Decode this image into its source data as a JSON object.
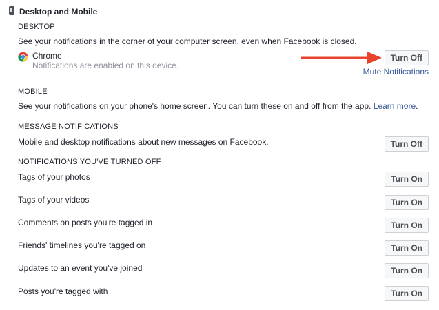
{
  "header": {
    "title": "Desktop and Mobile",
    "icon": "phone-icon"
  },
  "desktop": {
    "heading": "DESKTOP",
    "description": "See your notifications in the corner of your computer screen, even when Facebook is closed.",
    "browser_name": "Chrome",
    "browser_status": "Notifications are enabled on this device.",
    "button_label": "Turn Off",
    "mute_link": "Mute Notifications"
  },
  "mobile": {
    "heading": "MOBILE",
    "description": "See your notifications on your phone's home screen. You can turn these on and off from the app.",
    "learn_more": "Learn more",
    "period": "."
  },
  "messages": {
    "heading": "MESSAGE NOTIFICATIONS",
    "description": "Mobile and desktop notifications about new messages on Facebook.",
    "button_label": "Turn Off"
  },
  "turned_off": {
    "heading": "NOTIFICATIONS YOU'VE TURNED OFF",
    "items": [
      {
        "label": "Tags of your photos",
        "button_label": "Turn On"
      },
      {
        "label": "Tags of your videos",
        "button_label": "Turn On"
      },
      {
        "label": "Comments on posts you're tagged in",
        "button_label": "Turn On"
      },
      {
        "label": "Friends' timelines you're tagged on",
        "button_label": "Turn On"
      },
      {
        "label": "Updates to an event you've joined",
        "button_label": "Turn On"
      },
      {
        "label": "Posts you're tagged with",
        "button_label": "Turn On"
      }
    ]
  },
  "colors": {
    "link": "#365899",
    "arrow": "#e8432d",
    "muted": "#90949c"
  }
}
